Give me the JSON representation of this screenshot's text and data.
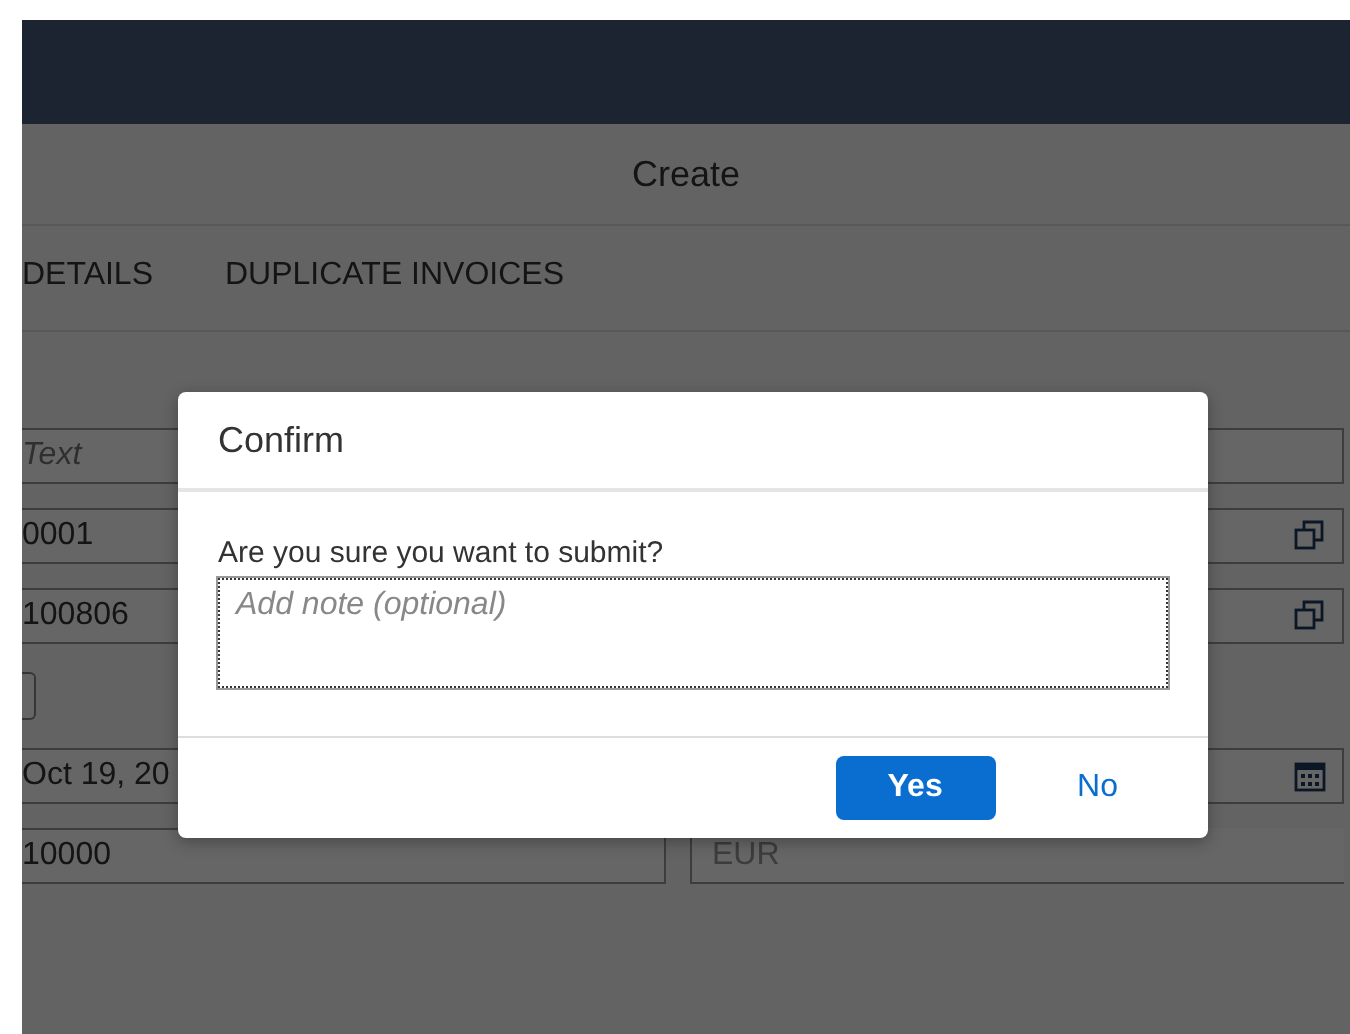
{
  "page": {
    "title": "Create",
    "tabs": [
      {
        "label": "DETAILS",
        "selected": false
      },
      {
        "label": "DUPLICATE INVOICES",
        "selected": false
      }
    ]
  },
  "form": {
    "rows": [
      {
        "kind": "text",
        "placeholder": "Text"
      },
      {
        "kind": "copy",
        "value": "0001"
      },
      {
        "kind": "copy",
        "value": "100806"
      },
      {
        "kind": "checkbox",
        "checked": false
      },
      {
        "kind": "date",
        "value": "Oct 19, 20"
      },
      {
        "kind": "amount",
        "value": "10000",
        "currency": "EUR"
      }
    ]
  },
  "dialog": {
    "title": "Confirm",
    "message": "Are you sure you want to submit?",
    "note": {
      "placeholder": "Add note (optional)"
    },
    "buttons": [
      {
        "label": "Yes",
        "kind": "emphasized"
      },
      {
        "label": "No",
        "kind": "transparent"
      }
    ]
  }
}
